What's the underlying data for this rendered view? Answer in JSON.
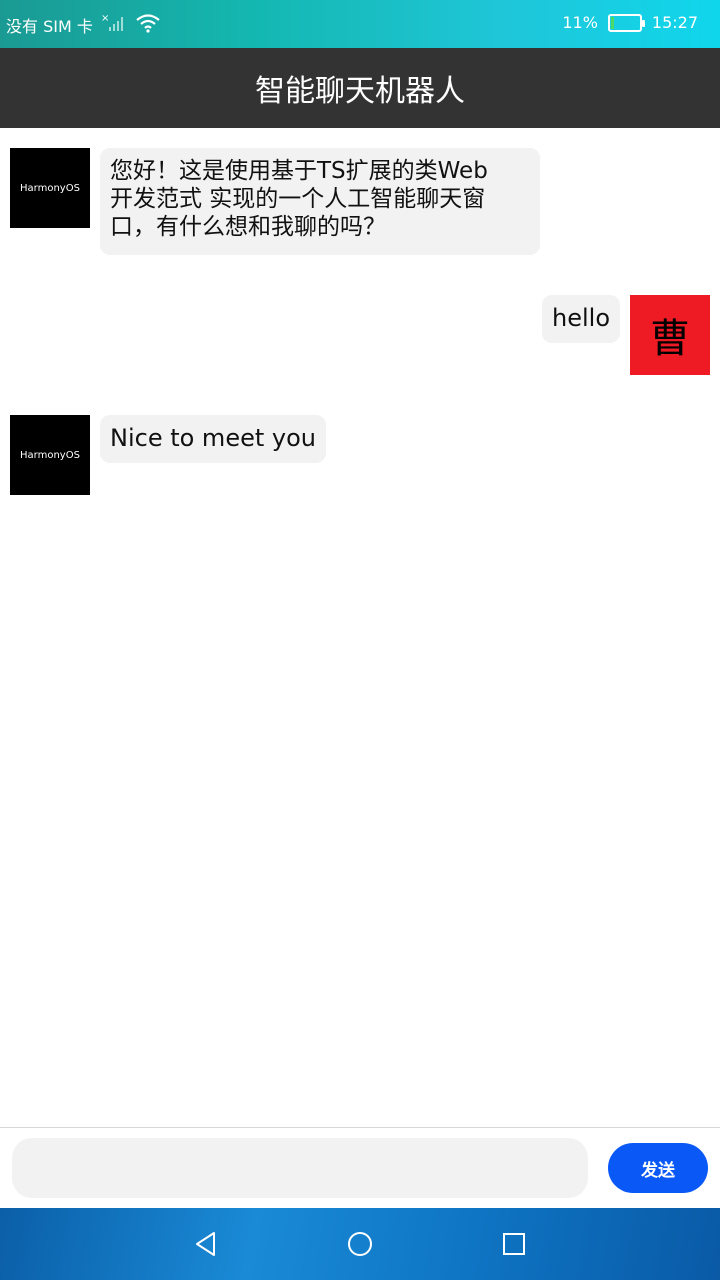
{
  "status_bar": {
    "carrier": "没有 SIM 卡",
    "battery_percent_text": "11%",
    "battery_level": 0.11,
    "time": "15:27"
  },
  "header": {
    "title": "智能聊天机器人"
  },
  "messages": [
    {
      "sender": "bot",
      "avatar_text": "HarmonyOS",
      "lines": [
        "您好！这是使用基于TS扩展的类Web",
        "开发范式 实现的一个人工智能聊天窗",
        "口，有什么想和我聊的吗？"
      ]
    },
    {
      "sender": "user",
      "avatar_text": "曹",
      "text": "hello"
    },
    {
      "sender": "bot",
      "avatar_text": "HarmonyOS",
      "text": "Nice to meet you"
    }
  ],
  "composer": {
    "value": "",
    "send_label": "发送"
  },
  "colors": {
    "title_bar": "#333333",
    "bubble": "#f2f2f2",
    "send_button": "#0a59f7",
    "user_avatar": "#ee1b24",
    "bot_avatar": "#000000"
  },
  "icons": {
    "signal": "signal-icon",
    "wifi": "wifi-icon",
    "back": "back-triangle-icon",
    "home": "home-circle-icon",
    "recents": "recents-square-icon"
  }
}
